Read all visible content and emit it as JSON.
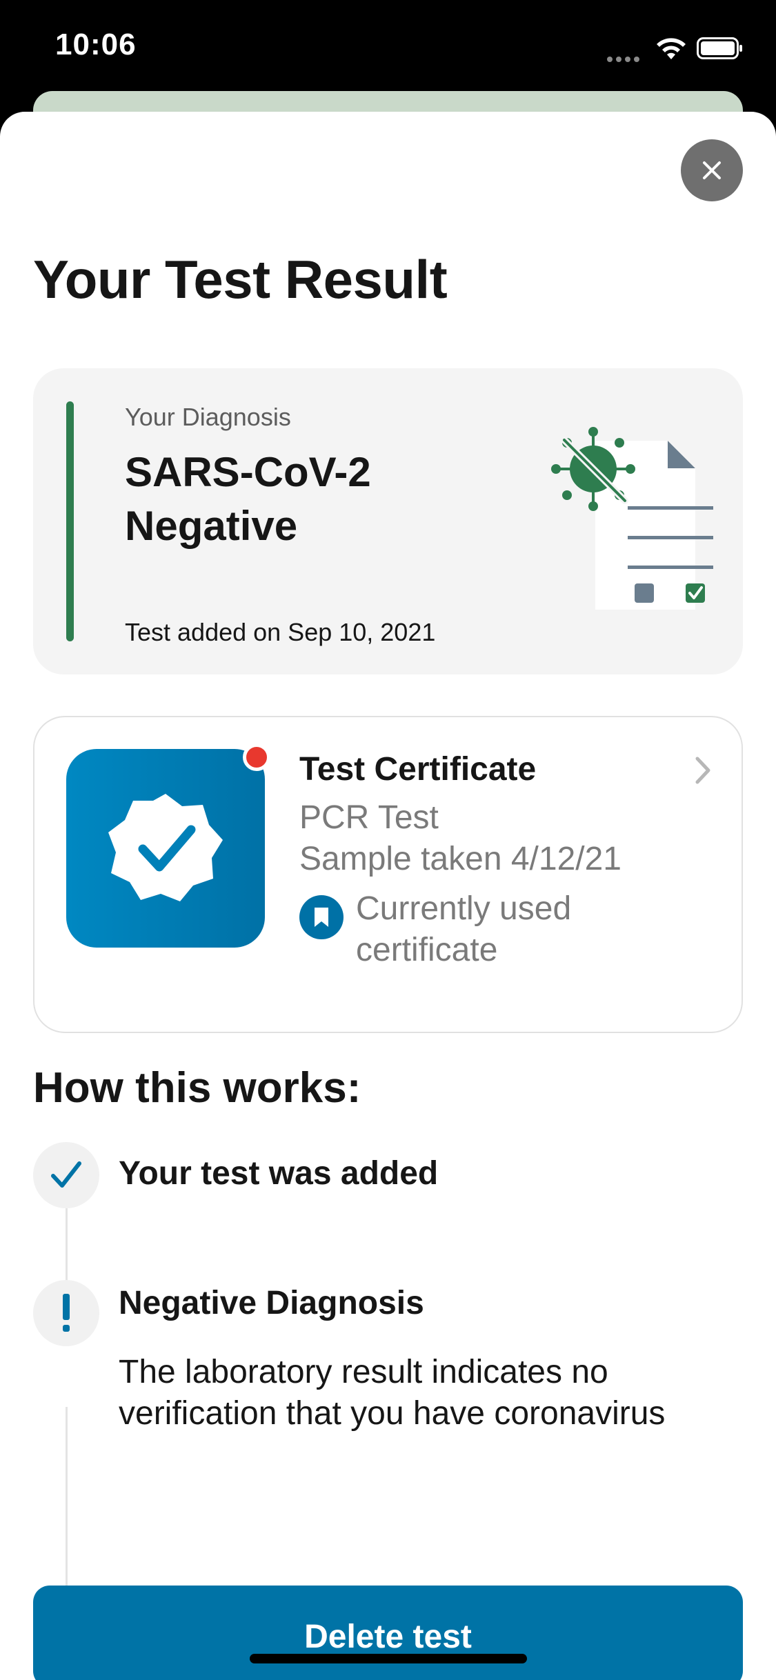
{
  "status_bar": {
    "time": "10:06",
    "signal_icon": "cellular-dots-icon",
    "wifi_icon": "wifi-icon",
    "battery_icon": "battery-icon"
  },
  "sheet": {
    "close_icon": "close-icon"
  },
  "page": {
    "title": "Your Test Result"
  },
  "diagnosis": {
    "label": "Your Diagnosis",
    "result_line1": "SARS-CoV-2",
    "result_line2": "Negative",
    "date": "Test added on Sep 10, 2021",
    "accent_color": "#2e7d4f",
    "illustration_icon": "document-virus-icon"
  },
  "certificate": {
    "title": "Test Certificate",
    "type": "PCR Test",
    "sample": "Sample taken 4/12/21",
    "used_line1": "Currently used",
    "used_line2": "certificate",
    "icon": "verified-badge-icon",
    "used_icon": "bookmark-icon",
    "chevron_icon": "chevron-right-icon",
    "notification_color": "#e8382e"
  },
  "how_it_works": {
    "title": "How this works:",
    "steps": [
      {
        "icon": "check-icon",
        "title": "Your test was added"
      },
      {
        "icon": "exclamation-icon",
        "title": "Negative Diagnosis",
        "text": "The laboratory result indicates no verification that you have coronavirus"
      }
    ]
  },
  "actions": {
    "delete_label": "Delete test",
    "button_color": "#0073a6"
  }
}
